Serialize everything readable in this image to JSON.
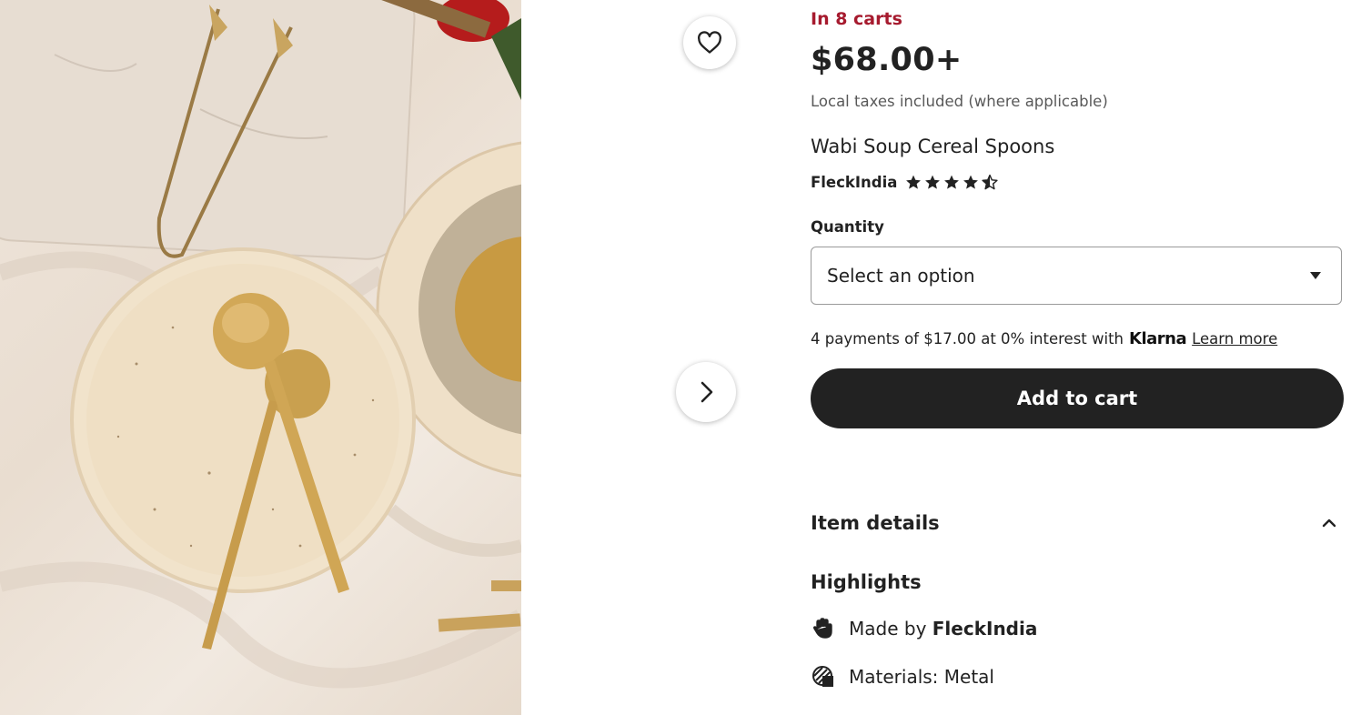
{
  "gallery": {
    "image_alt": "Wabi Soup Cereal Spoons product photo",
    "favorite_icon": "heart-icon",
    "next_icon": "chevron-right-icon"
  },
  "listing": {
    "in_carts": "In 8 carts",
    "price": "$68.00+",
    "taxes_note": "Local taxes included (where applicable)",
    "title": "Wabi Soup Cereal Spoons",
    "shop_name": "FleckIndia",
    "rating": 4.5
  },
  "quantity": {
    "label": "Quantity",
    "placeholder": "Select an option"
  },
  "klarna": {
    "text": "4 payments of $17.00 at 0% interest with",
    "brand": "Klarna",
    "learn_more": "Learn more"
  },
  "add_to_cart": "Add to cart",
  "details": {
    "title": "Item details",
    "highlights_title": "Highlights",
    "made_by_prefix": "Made by",
    "made_by_shop": "FleckIndia",
    "materials": "Materials: Metal"
  },
  "colors": {
    "accent_red": "#a61a2e",
    "button_dark": "#222222"
  }
}
